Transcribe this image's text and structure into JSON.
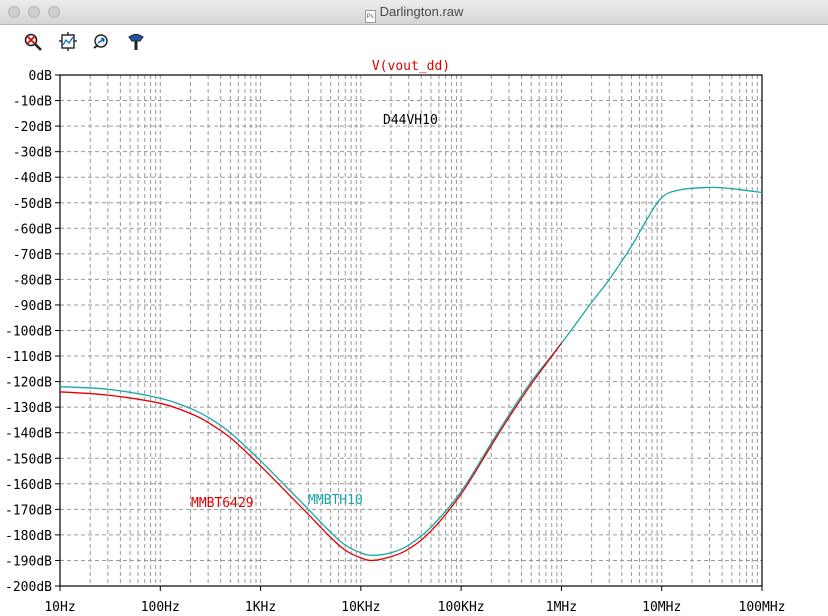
{
  "window": {
    "title": "Darlington.raw",
    "doc_icon_text": "Ps"
  },
  "toolbar": {
    "items": [
      "zoom-cancel",
      "autorange",
      "undo-zoom",
      "probe"
    ]
  },
  "colors": {
    "MMBT6429": "#e00000",
    "MMBTH10": "#1aa6a6",
    "D44VH10": "#000000",
    "D44VH10_trace": "#2a7a7a",
    "title": "#e00000",
    "grid": "#9a9a9a"
  },
  "chart_data": {
    "type": "line",
    "title": "V(vout_dd)",
    "xscale": "log",
    "xlim_hz": [
      10,
      100000000
    ],
    "ylim_db": [
      -200,
      0
    ],
    "grid": true,
    "x_tick_labels": [
      "10Hz",
      "100Hz",
      "1KHz",
      "10KHz",
      "100KHz",
      "1MHz",
      "10MHz",
      "100MHz"
    ],
    "y_tick_labels": [
      "0dB",
      "-10dB",
      "-20dB",
      "-30dB",
      "-40dB",
      "-50dB",
      "-60dB",
      "-70dB",
      "-80dB",
      "-90dB",
      "-100dB",
      "-110dB",
      "-120dB",
      "-130dB",
      "-140dB",
      "-150dB",
      "-160dB",
      "-170dB",
      "-180dB",
      "-190dB",
      "-200dB"
    ],
    "series": [
      {
        "name": "MMBTH10",
        "x_hz": [
          10,
          30,
          100,
          200,
          300,
          500,
          1000,
          2000,
          3000,
          5000,
          7000,
          10000,
          13000,
          20000,
          30000,
          50000,
          100000,
          200000,
          300000,
          500000,
          1000000,
          2000000,
          3000000,
          5000000,
          7000000,
          10000000,
          15000000,
          30000000,
          50000000,
          100000000
        ],
        "y_db": [
          -122,
          -123,
          -126.5,
          -130.5,
          -134,
          -140,
          -151,
          -163,
          -170,
          -179,
          -184,
          -187,
          -188,
          -187,
          -184,
          -177,
          -163,
          -144,
          -133,
          -120,
          -105,
          -89,
          -80,
          -67,
          -57,
          -48,
          -45,
          -44,
          -44.5,
          -46
        ]
      },
      {
        "name": "MMBT6429",
        "x_hz": [
          10,
          30,
          100,
          200,
          300,
          500,
          1000,
          2000,
          3000,
          5000,
          7000,
          10000,
          13000,
          20000,
          30000,
          50000,
          100000,
          200000,
          300000,
          500000,
          1000000
        ],
        "y_db": [
          -124,
          -125.3,
          -128.5,
          -132.5,
          -136,
          -142,
          -153,
          -165,
          -172,
          -181,
          -186,
          -189,
          -190,
          -188.5,
          -185.5,
          -178.5,
          -164,
          -145,
          -134,
          -121,
          -105
        ]
      }
    ],
    "annotations": [
      {
        "text": "MMBT6429",
        "series": "MMBT6429"
      },
      {
        "text": "MMBTH10",
        "series": "MMBTH10"
      },
      {
        "text": "D44VH10",
        "series": "D44VH10"
      }
    ]
  }
}
